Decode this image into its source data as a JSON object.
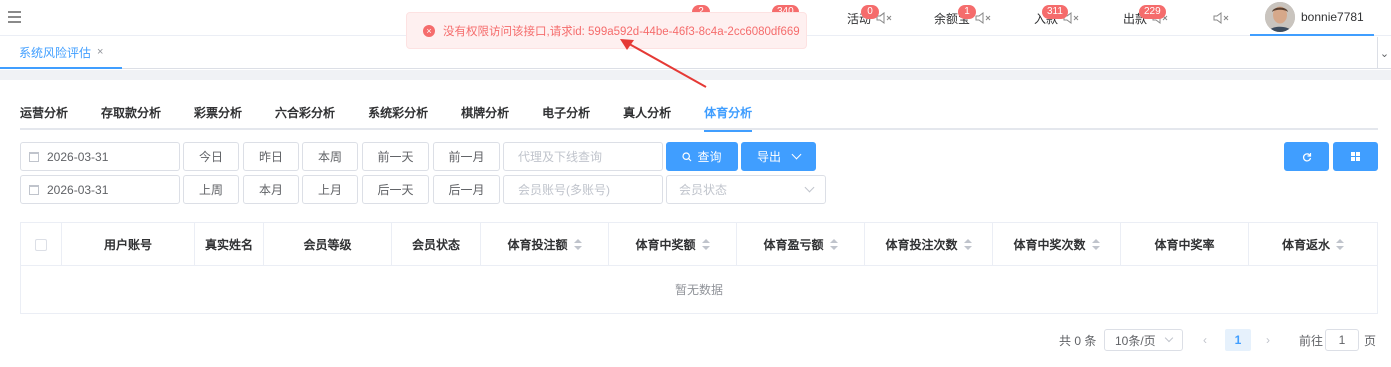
{
  "header": {
    "items": [
      {
        "badge": "2",
        "label": ""
      },
      {
        "badge": "340",
        "label": ""
      },
      {
        "badge": "0",
        "label": "活动"
      },
      {
        "badge": "1",
        "label": "余额宝"
      },
      {
        "badge": "311",
        "label": "入款"
      },
      {
        "badge": "229",
        "label": "出款"
      }
    ],
    "username": "bonnie7781"
  },
  "toast": {
    "message": "没有权限访问该接口,请求id: 599a592d-44be-46f3-8c4a-2cc6080df669"
  },
  "page_tab": {
    "label": "系统风险评估",
    "close": "×"
  },
  "subtabs": [
    "运营分析",
    "存取款分析",
    "彩票分析",
    "六合彩分析",
    "系统彩分析",
    "棋牌分析",
    "电子分析",
    "真人分析",
    "体育分析"
  ],
  "filters": {
    "date_start": "2026-03-31",
    "date_end": "2026-03-31",
    "row1_buttons": [
      "今日",
      "昨日",
      "本周",
      "前一天",
      "前一月"
    ],
    "row2_buttons": [
      "上周",
      "本月",
      "上月",
      "后一天",
      "后一月"
    ],
    "agent_placeholder": "代理及下线查询",
    "member_placeholder": "会员账号(多账号)",
    "status_placeholder": "会员状态",
    "query_label": "查询",
    "export_label": "导出"
  },
  "table": {
    "columns": [
      "用户账号",
      "真实姓名",
      "会员等级",
      "会员状态",
      "体育投注额",
      "体育中奖额",
      "体育盈亏额",
      "体育投注次数",
      "体育中奖次数",
      "体育中奖率",
      "体育返水"
    ],
    "empty_text": "暂无数据"
  },
  "pagination": {
    "total": "共 0 条",
    "page_size": "10条/页",
    "current_page": "1",
    "goto_label": "前往",
    "goto_value": "1",
    "page_suffix": "页"
  },
  "colors": {
    "primary": "#409eff",
    "danger": "#f56c6c"
  }
}
